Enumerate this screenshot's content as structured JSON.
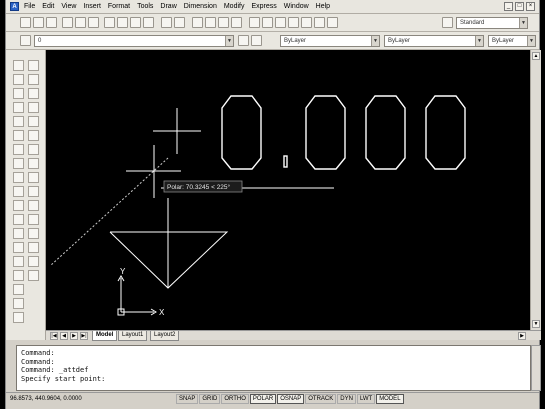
{
  "menu": [
    "File",
    "Edit",
    "View",
    "Insert",
    "Format",
    "Tools",
    "Draw",
    "Dimension",
    "Modify",
    "Express",
    "Window",
    "Help"
  ],
  "toolbar": {
    "text_style": "Standard",
    "layer": "ByLayer",
    "color": "ByLayer",
    "linetype": "ByLayer",
    "lineweight": "ByLayer",
    "layer_combo_text": "0"
  },
  "drawing": {
    "text": "0.000",
    "tooltip": "Polar: 70.3245 < 225°",
    "ucs_x": "X",
    "ucs_y": "Y"
  },
  "tabs": [
    "Model",
    "Layout1",
    "Layout2"
  ],
  "command": {
    "lines": [
      "Command:",
      "Command:",
      "Command: _attdef",
      "Specify start point:"
    ]
  },
  "status": {
    "coords": "96.8573, 440.9604, 0.0000",
    "buttons": [
      {
        "label": "SNAP",
        "on": false
      },
      {
        "label": "GRID",
        "on": false
      },
      {
        "label": "ORTHO",
        "on": false
      },
      {
        "label": "POLAR",
        "on": true
      },
      {
        "label": "OSNAP",
        "on": true
      },
      {
        "label": "OTRACK",
        "on": false
      },
      {
        "label": "DYN",
        "on": false
      },
      {
        "label": "LWT",
        "on": false
      },
      {
        "label": "MODEL",
        "on": true
      }
    ]
  },
  "colors": {
    "canvas": "#000000",
    "drawing_lines": "#ffffff",
    "tooltip_bg": "#1c1c1c"
  }
}
